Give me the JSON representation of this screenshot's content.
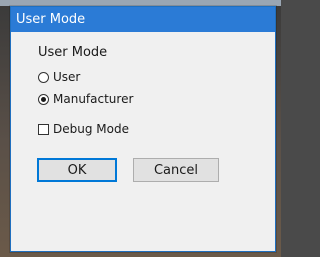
{
  "window": {
    "title": "User Mode"
  },
  "group": {
    "label": "User Mode"
  },
  "options": {
    "user_label": "User",
    "manufacturer_label": "Manufacturer",
    "selected": "manufacturer"
  },
  "debug": {
    "label": "Debug Mode",
    "checked": false
  },
  "buttons": {
    "ok_label": "OK",
    "cancel_label": "Cancel"
  },
  "colors": {
    "titlebar": "#2b7bd6",
    "accent": "#0078d7",
    "dialog_bg": "#f0f0f0"
  }
}
